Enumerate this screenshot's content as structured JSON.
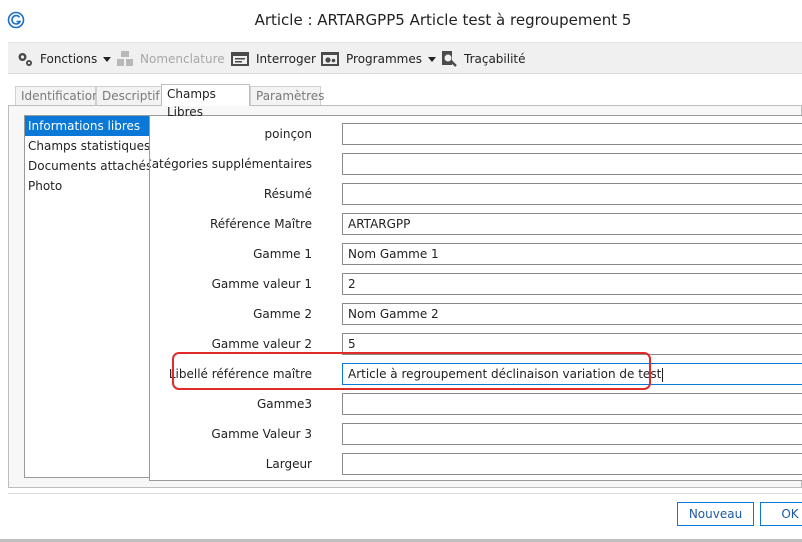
{
  "window": {
    "title": "Article : ARTARGPP5 Article test à regroupement 5"
  },
  "toolbar": {
    "fonctions": "Fonctions",
    "nomenclature": "Nomenclature",
    "interroger": "Interroger",
    "programmes": "Programmes",
    "tracabilite": "Traçabilité"
  },
  "tabs": [
    "Identification",
    "Descriptif",
    "Champs Libres",
    "Paramètres"
  ],
  "active_tab": "Champs Libres",
  "sidebar": {
    "items": [
      "Informations libres",
      "Champs statistiques",
      "Documents attachés",
      "Photo"
    ]
  },
  "form": {
    "fields": [
      {
        "label": "poinçon",
        "value": ""
      },
      {
        "label": "Catégories supplémentaires",
        "value": ""
      },
      {
        "label": "Résumé",
        "value": ""
      },
      {
        "label": "Référence Maître",
        "value": "ARTARGPP"
      },
      {
        "label": "Gamme 1",
        "value": "Nom Gamme 1"
      },
      {
        "label": "Gamme valeur 1",
        "value": "2"
      },
      {
        "label": "Gamme 2",
        "value": "Nom Gamme 2"
      },
      {
        "label": "Gamme valeur 2",
        "value": "5"
      },
      {
        "label": "Libellé référence maître",
        "value": "Article à regroupement déclinaison variation de test"
      },
      {
        "label": "Gamme3",
        "value": ""
      },
      {
        "label": "Gamme Valeur 3",
        "value": ""
      },
      {
        "label": "Largeur",
        "value": ""
      }
    ]
  },
  "footer": {
    "nouveau": "Nouveau",
    "ok": "OK"
  },
  "colors": {
    "accent": "#0a78d7",
    "highlight": "#e12a2a"
  }
}
